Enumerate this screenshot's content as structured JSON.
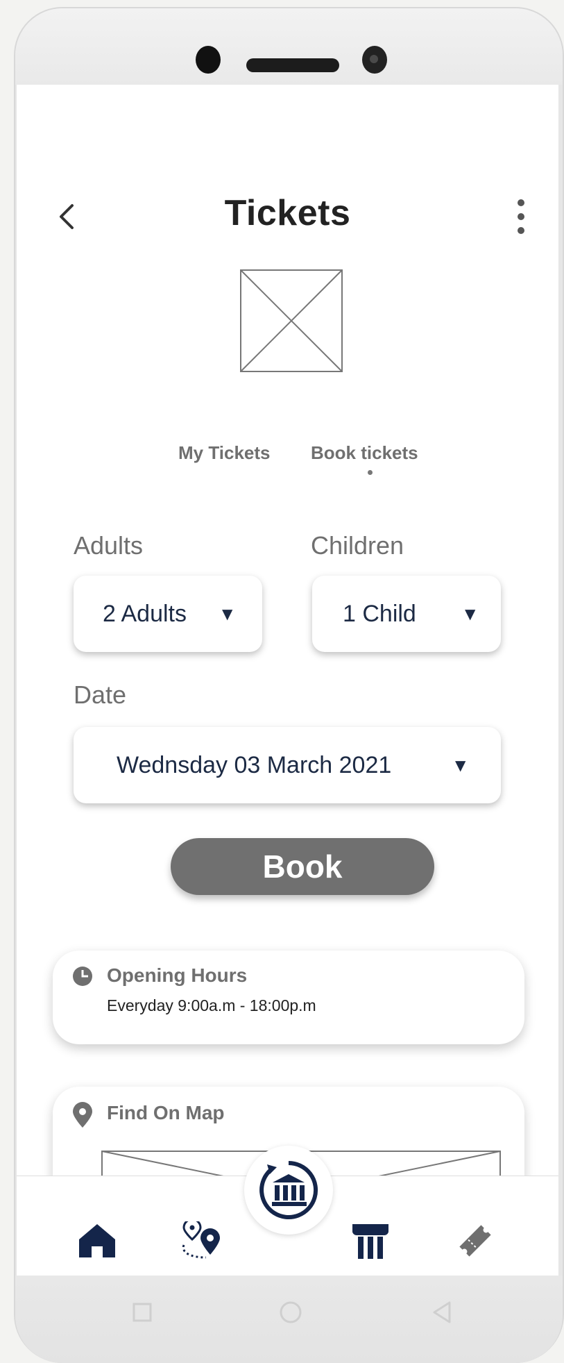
{
  "header": {
    "title": "Tickets"
  },
  "tabs": [
    {
      "label": "My Tickets"
    },
    {
      "label": "Book tickets",
      "active": true
    }
  ],
  "form": {
    "adults": {
      "label": "Adults",
      "value": "2 Adults"
    },
    "children": {
      "label": "Children",
      "value": "1 Child"
    },
    "date": {
      "label": "Date",
      "value": "Wednsday 03 March 2021"
    }
  },
  "book_button": {
    "label": "Book"
  },
  "opening_hours": {
    "title": "Opening Hours",
    "text": "Everyday  9:00a.m - 18:00p.m"
  },
  "map_card": {
    "title": "Find On Map"
  },
  "bottom_nav": {
    "items": [
      {
        "icon": "home-icon"
      },
      {
        "icon": "route-map-icon"
      },
      {
        "icon": "museum-icon"
      },
      {
        "icon": "column-icon"
      },
      {
        "icon": "ticket-icon"
      }
    ]
  },
  "colors": {
    "navy": "#14254a",
    "gray": "#707070"
  }
}
